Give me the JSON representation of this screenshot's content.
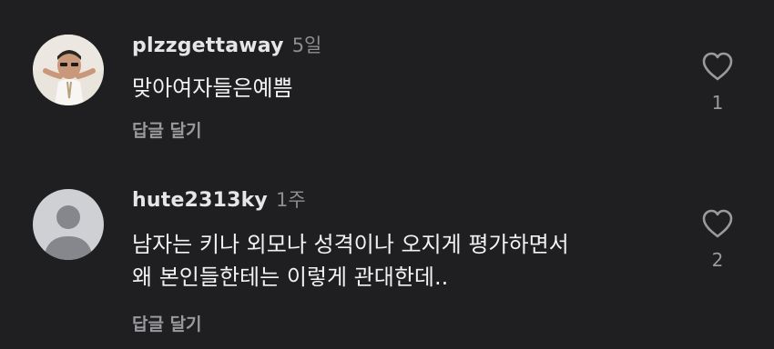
{
  "comments": [
    {
      "username": "plzzgettaway",
      "time": "5일",
      "text_lines": [
        "맞아여자들은예쁨"
      ],
      "reply_label": "답글 달기",
      "like_count": "1",
      "avatar": "photo-avatar"
    },
    {
      "username": "hute2313ky",
      "time": "1주",
      "text_lines": [
        "남자는 키나 외모나 성격이나 오지게 평가하면서",
        "왜 본인들한테는 이렇게 관대한데.."
      ],
      "reply_label": "답글 달기",
      "like_count": "2",
      "avatar": "default-user-avatar"
    }
  ],
  "icons": {
    "like": "heart-outline-icon"
  },
  "colors": {
    "background": "#1f1f21",
    "username": "#e6e6e6",
    "secondary": "#8e8e92",
    "text": "#f2f2f2"
  }
}
